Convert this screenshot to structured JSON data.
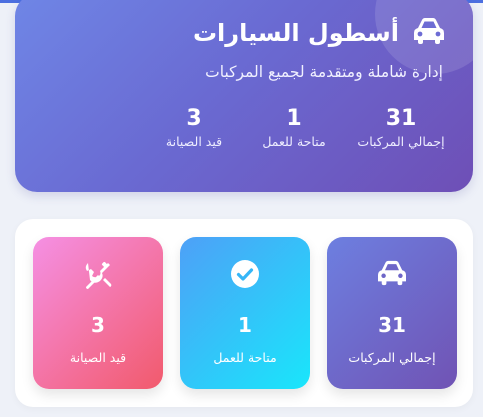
{
  "hero": {
    "title": "أسطول السيارات",
    "subtitle": "إدارة شاملة ومتقدمة لجميع المركبات",
    "title_icon": "car-icon",
    "stats": [
      {
        "value": "31",
        "label": "إجمالي المركبات"
      },
      {
        "value": "1",
        "label": "متاحة للعمل"
      },
      {
        "value": "3",
        "label": "قيد الصيانة"
      }
    ]
  },
  "cards": [
    {
      "value": "31",
      "label": "إجمالي المركبات",
      "icon": "car-icon"
    },
    {
      "value": "1",
      "label": "متاحة للعمل",
      "icon": "check-circle-icon"
    },
    {
      "value": "3",
      "label": "قيد الصيانة",
      "icon": "tools-icon"
    }
  ],
  "colors": {
    "hero_start": "#6f86e6",
    "hero_end": "#6e4fb6",
    "available_start": "#4ea0f7",
    "available_end": "#19e6fb",
    "maintenance_start": "#f590e4",
    "maintenance_end": "#f25a6c"
  }
}
